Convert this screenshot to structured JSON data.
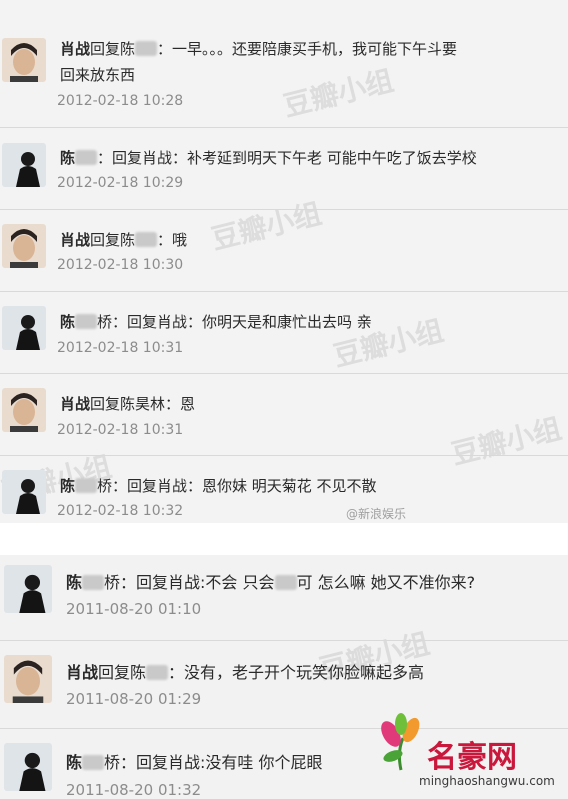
{
  "top": {
    "messages": [
      {
        "author": "肖战",
        "text1": "回复陈",
        "text2": "：一早。。。还要陪康买手机，我可能下午斗要",
        "text3": "回来放东西",
        "time": "2012-02-18 10:28"
      },
      {
        "author": "陈",
        "text1": "",
        "text2": "：回复肖战：补考延到明天下午老 可能中午吃了饭去学校",
        "text3": "",
        "time": "2012-02-18 10:29"
      },
      {
        "author": "肖战",
        "text1": "回复陈",
        "text2": "：哦",
        "text3": "",
        "time": "2012-02-18 10:30"
      },
      {
        "author": "陈",
        "text1": "",
        "text2": "桥：回复肖战：你明天是和康忙出去吗 亲",
        "text3": "",
        "time": "2012-02-18 10:31"
      },
      {
        "author": "肖战",
        "text1": "回复陈昊林：恩",
        "text2": "",
        "text3": "",
        "time": "2012-02-18 10:31"
      },
      {
        "author": "陈",
        "text1": "",
        "text2": "桥：回复肖战：恩你妹 明天菊花 不见不散",
        "text3": "",
        "time": "2012-02-18 10:32"
      }
    ]
  },
  "bottom": {
    "messages": [
      {
        "author": "陈",
        "text1": "",
        "text2": "桥：回复肖战:不会 只会",
        "text3": "可 怎么嘛 她又不准你来?",
        "time": "2011-08-20 01:10"
      },
      {
        "author": "肖战",
        "text1": "回复陈",
        "text2": "：没有，老子开个玩笑你脸嘛起多高",
        "text3": "",
        "time": "2011-08-20 01:29"
      },
      {
        "author": "陈",
        "text1": "",
        "text2": "桥：回复肖战:没有哇 你个屁眼",
        "text3": "",
        "time": "2011-08-20 01:32"
      }
    ]
  },
  "watermarks": {
    "douban": "豆瓣小组"
  },
  "logo": {
    "brand": "名豪网",
    "url": "minghaoshangwu.com"
  },
  "weibo_wm": "@新浪娱乐"
}
